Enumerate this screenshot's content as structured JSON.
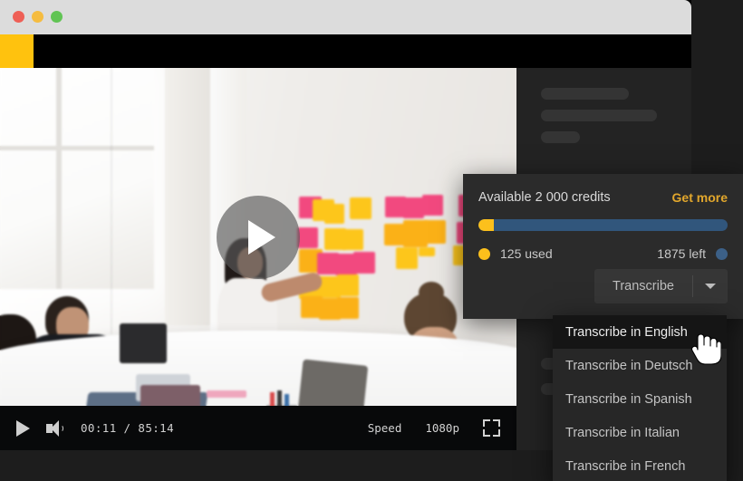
{
  "window": {
    "traffic_lights": [
      "close",
      "minimize",
      "maximize"
    ],
    "brand_color": "#ffc20e",
    "toolbar_color": "#000000"
  },
  "video": {
    "play_button_label": "play-overlay",
    "controls": {
      "play_label": "Play",
      "volume_label": "Volume",
      "current_time": "00:11",
      "separator": "/",
      "duration": "85:14",
      "timecode": "00:11 / 85:14",
      "speed_label": "Speed",
      "quality_label": "1080p",
      "fullscreen_label": "Fullscreen"
    }
  },
  "sidebar": {
    "skeleton_count": 5
  },
  "credits": {
    "title": "Available 2 000 credits",
    "get_more_label": "Get more",
    "used_label": "125 used",
    "left_label": "1875 left",
    "used_value": 125,
    "left_value": 1875,
    "total_value": 2000,
    "used_percent": 6.25,
    "used_color": "#fcc01c",
    "remaining_color": "#31567c",
    "accent_color": "#e2a72c",
    "transcribe_button": "Transcribe"
  },
  "dropdown": {
    "items": [
      {
        "label": "Transcribe in English",
        "active": true
      },
      {
        "label": "Transcribe in Deutsch",
        "active": false
      },
      {
        "label": "Transcribe in Spanish",
        "active": false
      },
      {
        "label": "Transcribe in Italian",
        "active": false
      },
      {
        "label": "Transcribe in French",
        "active": false
      }
    ]
  }
}
